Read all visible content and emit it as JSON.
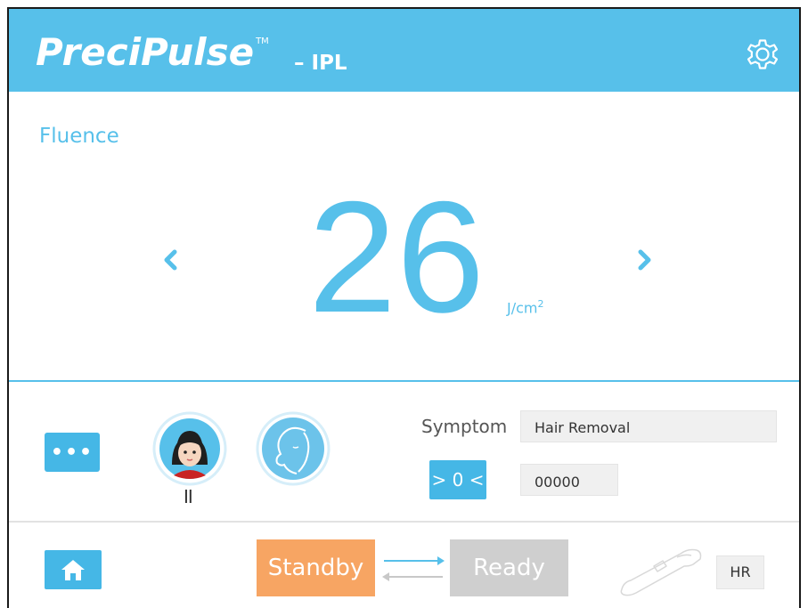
{
  "header": {
    "brand": "PreciPulse",
    "trademark": "TM",
    "subtitle": "– IPL",
    "settings_icon": "gear-icon",
    "background_color": "#57c0ea"
  },
  "fluence": {
    "label": "Fluence",
    "value": "26",
    "unit": "J/cm",
    "unit_exponent": "2",
    "decrease_icon": "chevron-left-icon",
    "increase_icon": "chevron-right-icon"
  },
  "controls": {
    "more_label": "•••",
    "skin_type": "II",
    "skin_avatar_icon": "skin-type-avatar-icon",
    "face_profile_icon": "face-profile-icon",
    "symptom_label": "Symptom",
    "symptom_value": "Hair Removal",
    "reset_label": "> 0 <",
    "counter_value": "00000"
  },
  "footer": {
    "home_icon": "home-icon",
    "standby_label": "Standby",
    "ready_label": "Ready",
    "handpiece_icon": "handpiece-icon",
    "handpiece_mode": "HR"
  },
  "colors": {
    "accent": "#57c0ea",
    "button_blue": "#45b7e6",
    "standby": "#f7a563",
    "ready_inactive": "#cfcfcf"
  }
}
